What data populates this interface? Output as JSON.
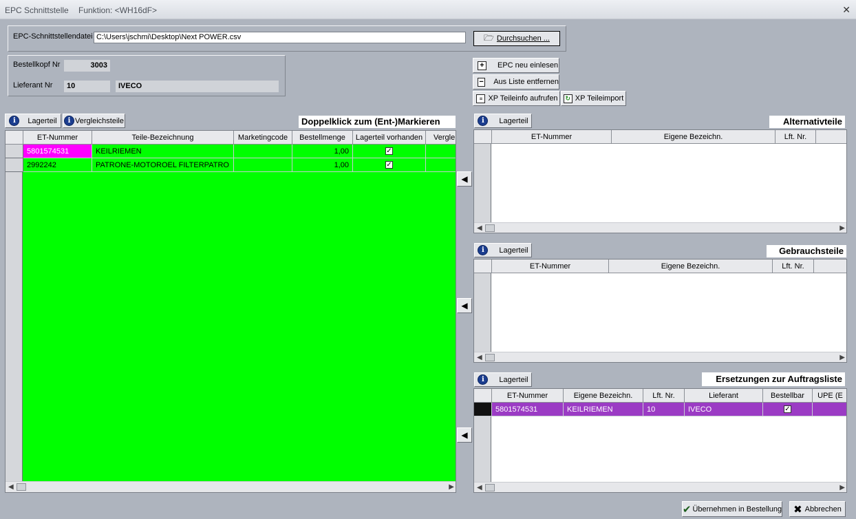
{
  "window": {
    "title": "EPC Schnittstelle",
    "function": "Funktion: <WH16dF>"
  },
  "file": {
    "label": "EPC-Schnittstellendatei",
    "path": "C:\\Users\\jschmi\\Desktop\\Next POWER.csv",
    "browse_label": "Durchsuchen ..."
  },
  "order": {
    "bestellkopf_label": "Bestellkopf Nr",
    "bestellkopf_value": "3003",
    "lieferant_label": "Lieferant Nr",
    "lieferant_nr": "10",
    "lieferant_name": "IVECO"
  },
  "actions": {
    "epc_reload": "EPC neu einlesen",
    "remove_from_list": "Aus Liste entfernen",
    "xp_info": "XP Teileinfo aufrufen",
    "xp_import": "XP Teileimport"
  },
  "main_panel": {
    "lagerteil_label": "Lagerteil",
    "vergleichsteile_label": "Vergleichsteile",
    "title": "Doppelklick zum (Ent-)Markieren",
    "columns": [
      "ET-Nummer",
      "Teile-Bezeichnung",
      "Marketingcode",
      "Bestellmenge",
      "Lagerteil vorhanden",
      "Vergle"
    ],
    "rows": [
      {
        "et": "5801574531",
        "bez": "KEILRIEMEN",
        "mc": "",
        "menge": "1,00",
        "lager": true
      },
      {
        "et": "2992242",
        "bez": "PATRONE-MOTOROEL FILTERPATRO",
        "mc": "",
        "menge": "1,00",
        "lager": true
      }
    ]
  },
  "alt_panel": {
    "lagerteil_label": "Lagerteil",
    "title": "Alternativteile",
    "columns": [
      "ET-Nummer",
      "Eigene Bezeichn.",
      "Lft. Nr."
    ]
  },
  "use_panel": {
    "lagerteil_label": "Lagerteil",
    "title": "Gebrauchsteile",
    "columns": [
      "ET-Nummer",
      "Eigene Bezeichn.",
      "Lft. Nr."
    ]
  },
  "rep_panel": {
    "lagerteil_label": "Lagerteil",
    "title": "Ersetzungen zur Auftragsliste",
    "columns": [
      "ET-Nummer",
      "Eigene Bezeichn.",
      "Lft. Nr.",
      "Lieferant",
      "Bestellbar",
      "UPE (E"
    ],
    "rows": [
      {
        "et": "5801574531",
        "bez": "KEILRIEMEN",
        "lft": "10",
        "lieferant": "IVECO",
        "bestellbar": true
      }
    ]
  },
  "footer": {
    "apply_label": "Übernehmen in Bestellung",
    "cancel_label": "Abbrechen"
  },
  "colors": {
    "main_grid_bg": "#00ff00",
    "highlight_cell": "#ff00ff",
    "selected_row": "#9b3bc4"
  }
}
